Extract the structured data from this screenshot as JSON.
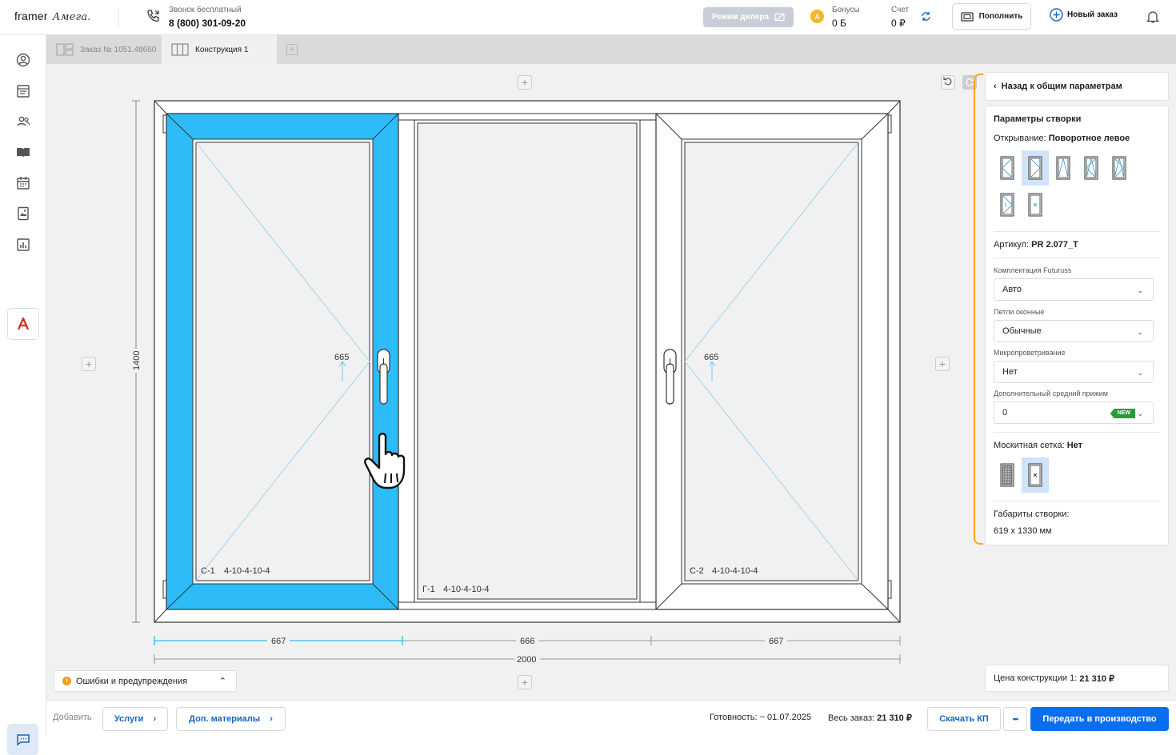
{
  "app": {
    "brand": "framer",
    "brand2": "Амега."
  },
  "header": {
    "call_label": "Звонок бесплатный",
    "phone": "8 (800) 301-09-20",
    "dealer_mode": "Режим дилера",
    "bonus_label": "Бонусы",
    "bonus_value": "0 Б",
    "bonus_coin": "A",
    "account_label": "Счет",
    "account_value": "0 ₽",
    "refill": "Пополнить",
    "new_order": "Новый заказ"
  },
  "tabs": [
    {
      "label": "Заказ № 1051.48660",
      "active": false
    },
    {
      "label": "Конструкция 1",
      "active": true
    }
  ],
  "drawing": {
    "sash_left": "С-1",
    "sash_left_glass": "4-10-4-10-4",
    "fixed": "Г-1",
    "fixed_glass": "4-10-4-10-4",
    "sash_right": "С-2",
    "sash_right_glass": "4-10-4-10-4",
    "handle_height_left": "665",
    "handle_height_right": "665",
    "height": "1400",
    "widths": [
      "667",
      "666",
      "667"
    ],
    "total_width": "2000"
  },
  "panel": {
    "back": "Назад к общим параметрам",
    "sash_params_title": "Параметры створки",
    "opening_label": "Открывание:",
    "opening_value": "Поворотное левое",
    "article_label": "Артикул:",
    "article_value": "PR 2.077_T",
    "fields": [
      {
        "label": "Комплектация Futuruss",
        "value": "Авто"
      },
      {
        "label": "Петли оконные",
        "value": "Обычные"
      },
      {
        "label": "Микропроветривание",
        "value": "Нет"
      },
      {
        "label": "Дополнительный средний прижим",
        "value": "0",
        "badge": "NEW"
      }
    ],
    "mosquito_label": "Москитная сетка:",
    "mosquito_value": "Нет",
    "dims_label": "Габариты створки:",
    "dims_value": "619 x 1330 мм"
  },
  "errors": "Ошибки и предупреждения",
  "price": {
    "label": "Цена конструкции 1:",
    "value": "21 310 ₽"
  },
  "bottom": {
    "add": "Добавить",
    "services": "Услуги",
    "extra": "Доп. материалы",
    "ready_label": "Готовность:",
    "ready_value": "~ 01.07.2025",
    "total_label": "Весь заказ:",
    "total_value": "21 310 ₽",
    "download": "Скачать КП",
    "more": "•••",
    "submit": "Передать в производство"
  },
  "colors": {
    "accent": "#0a6ef0",
    "selected_sash": "#2ebcf8",
    "panel_accent": "#f5a623"
  }
}
